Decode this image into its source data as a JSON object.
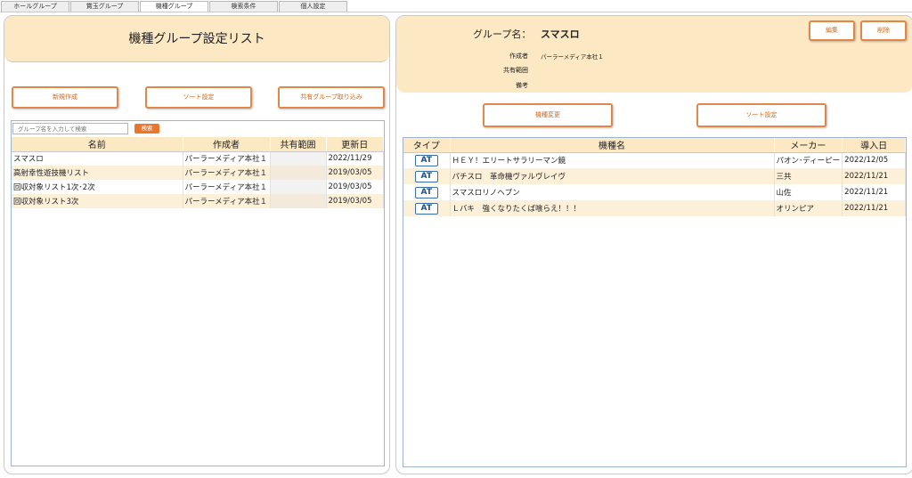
{
  "tabs": [
    {
      "label": "ホールグループ",
      "active": false
    },
    {
      "label": "賞玉グループ",
      "active": false
    },
    {
      "label": "機種グループ",
      "active": true
    },
    {
      "label": "検索条件",
      "active": false
    },
    {
      "label": "個人設定",
      "active": false
    }
  ],
  "left": {
    "title": "機種グループ設定リスト",
    "buttons": {
      "new": "新規作成",
      "sort": "ソート設定",
      "import": "共有グループ取り込み"
    },
    "search": {
      "placeholder": "グループ名を入力して検索",
      "button": "検索"
    },
    "columns": [
      "名前",
      "作成者",
      "共有範囲",
      "更新日"
    ],
    "rows": [
      {
        "name": "スマスロ",
        "creator": "パーラーメディア本社１",
        "shared": "",
        "updated": "2022/11/29"
      },
      {
        "name": "高射幸性遊技機リスト",
        "creator": "パーラーメディア本社１",
        "shared": "",
        "updated": "2019/03/05"
      },
      {
        "name": "回収対象リスト1次･2次",
        "creator": "パーラーメディア本社１",
        "shared": "",
        "updated": "2019/03/05"
      },
      {
        "name": "回収対象リスト3次",
        "creator": "パーラーメディア本社１",
        "shared": "",
        "updated": "2019/03/05"
      }
    ]
  },
  "right": {
    "group_label": "グループ名：",
    "group_name": "スマスロ",
    "buttons": {
      "edit": "編集",
      "delete": "削除",
      "change": "機種変更",
      "sort": "ソート設定"
    },
    "meta": {
      "creator_label": "作成者",
      "creator_value": "パーラーメディア本社１",
      "shared_label": "共有範囲",
      "shared_value": "",
      "note_label": "備考",
      "note_value": ""
    },
    "columns": [
      "タイプ",
      "機種名",
      "メーカー",
      "導入日"
    ],
    "rows": [
      {
        "type": "AT",
        "name": "ＨＥＹ！エリートサラリーマン鏡",
        "maker": "パオン･ディーピー",
        "date": "2022/12/05"
      },
      {
        "type": "AT",
        "name": "パチスロ　革命機ヴァルヴレイヴ",
        "maker": "三共",
        "date": "2022/11/21"
      },
      {
        "type": "AT",
        "name": "スマスロリノヘブン",
        "maker": "山佐",
        "date": "2022/11/21"
      },
      {
        "type": "AT",
        "name": "Ｌバキ　強くなりたくば喰らえ！！！",
        "maker": "オリンピア",
        "date": "2022/11/21"
      }
    ]
  },
  "colors": {
    "accent": "#e9762b",
    "header_bg": "#fde8c4",
    "row_alt": "#fdf0d9",
    "badge": "#1f4f8a"
  }
}
